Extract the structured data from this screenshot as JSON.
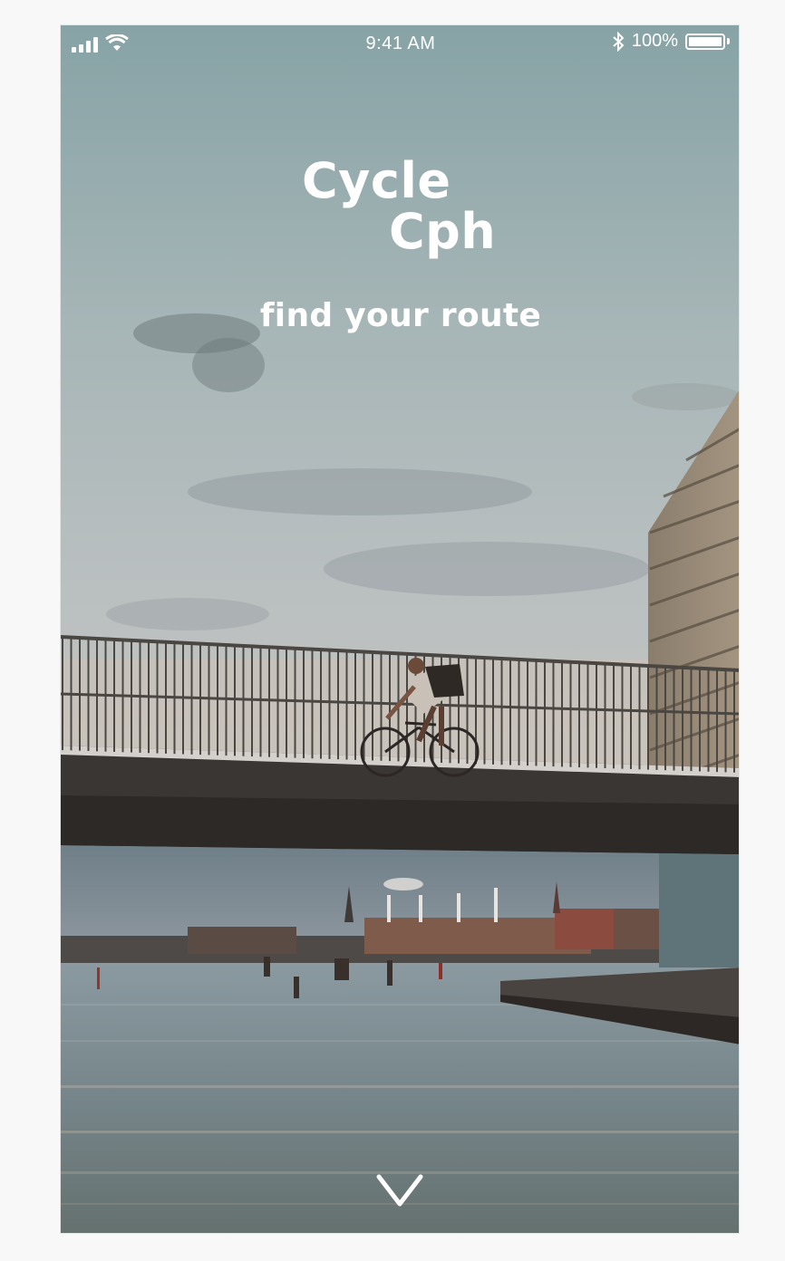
{
  "status_bar": {
    "time": "9:41 AM",
    "battery_percent": "100%",
    "battery_level": 1.0,
    "icons": [
      "signal-icon",
      "wifi-icon",
      "bluetooth-icon",
      "battery-icon"
    ]
  },
  "app": {
    "title_line1": "Cycle",
    "title_line2": "Cph",
    "tagline": "find your route"
  },
  "hero": {
    "image_description_icon": "background-photo"
  },
  "scroll": {
    "icon": "chevron-down-icon"
  },
  "colors": {
    "text": "#ffffff",
    "sky_top": "#8ea8aa",
    "sky_bottom": "#b9c0c2",
    "water": "#7b8a90"
  }
}
